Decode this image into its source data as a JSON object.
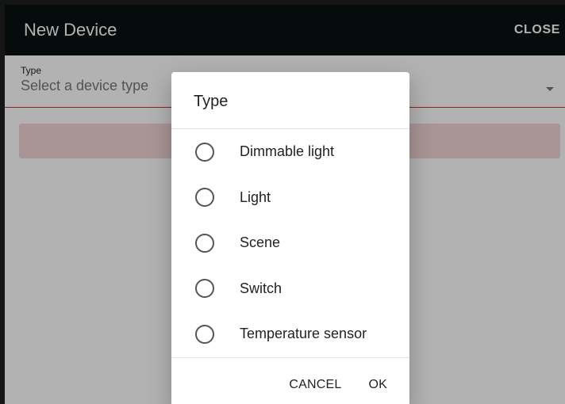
{
  "app_bar": {
    "title": "New Device",
    "close_label": "CLOSE"
  },
  "form": {
    "type_label": "Type",
    "type_placeholder": "Select a device type"
  },
  "dialog": {
    "title": "Type",
    "options": [
      {
        "label": "Dimmable light",
        "selected": false
      },
      {
        "label": "Light",
        "selected": false
      },
      {
        "label": "Scene",
        "selected": false
      },
      {
        "label": "Switch",
        "selected": false
      },
      {
        "label": "Temperature sensor",
        "selected": false
      }
    ],
    "actions": {
      "cancel_label": "CANCEL",
      "ok_label": "OK"
    }
  },
  "colors": {
    "app_bar_bg": "#0a1212",
    "error_red": "#d32f2f",
    "error_bg": "#f3d6d6"
  }
}
